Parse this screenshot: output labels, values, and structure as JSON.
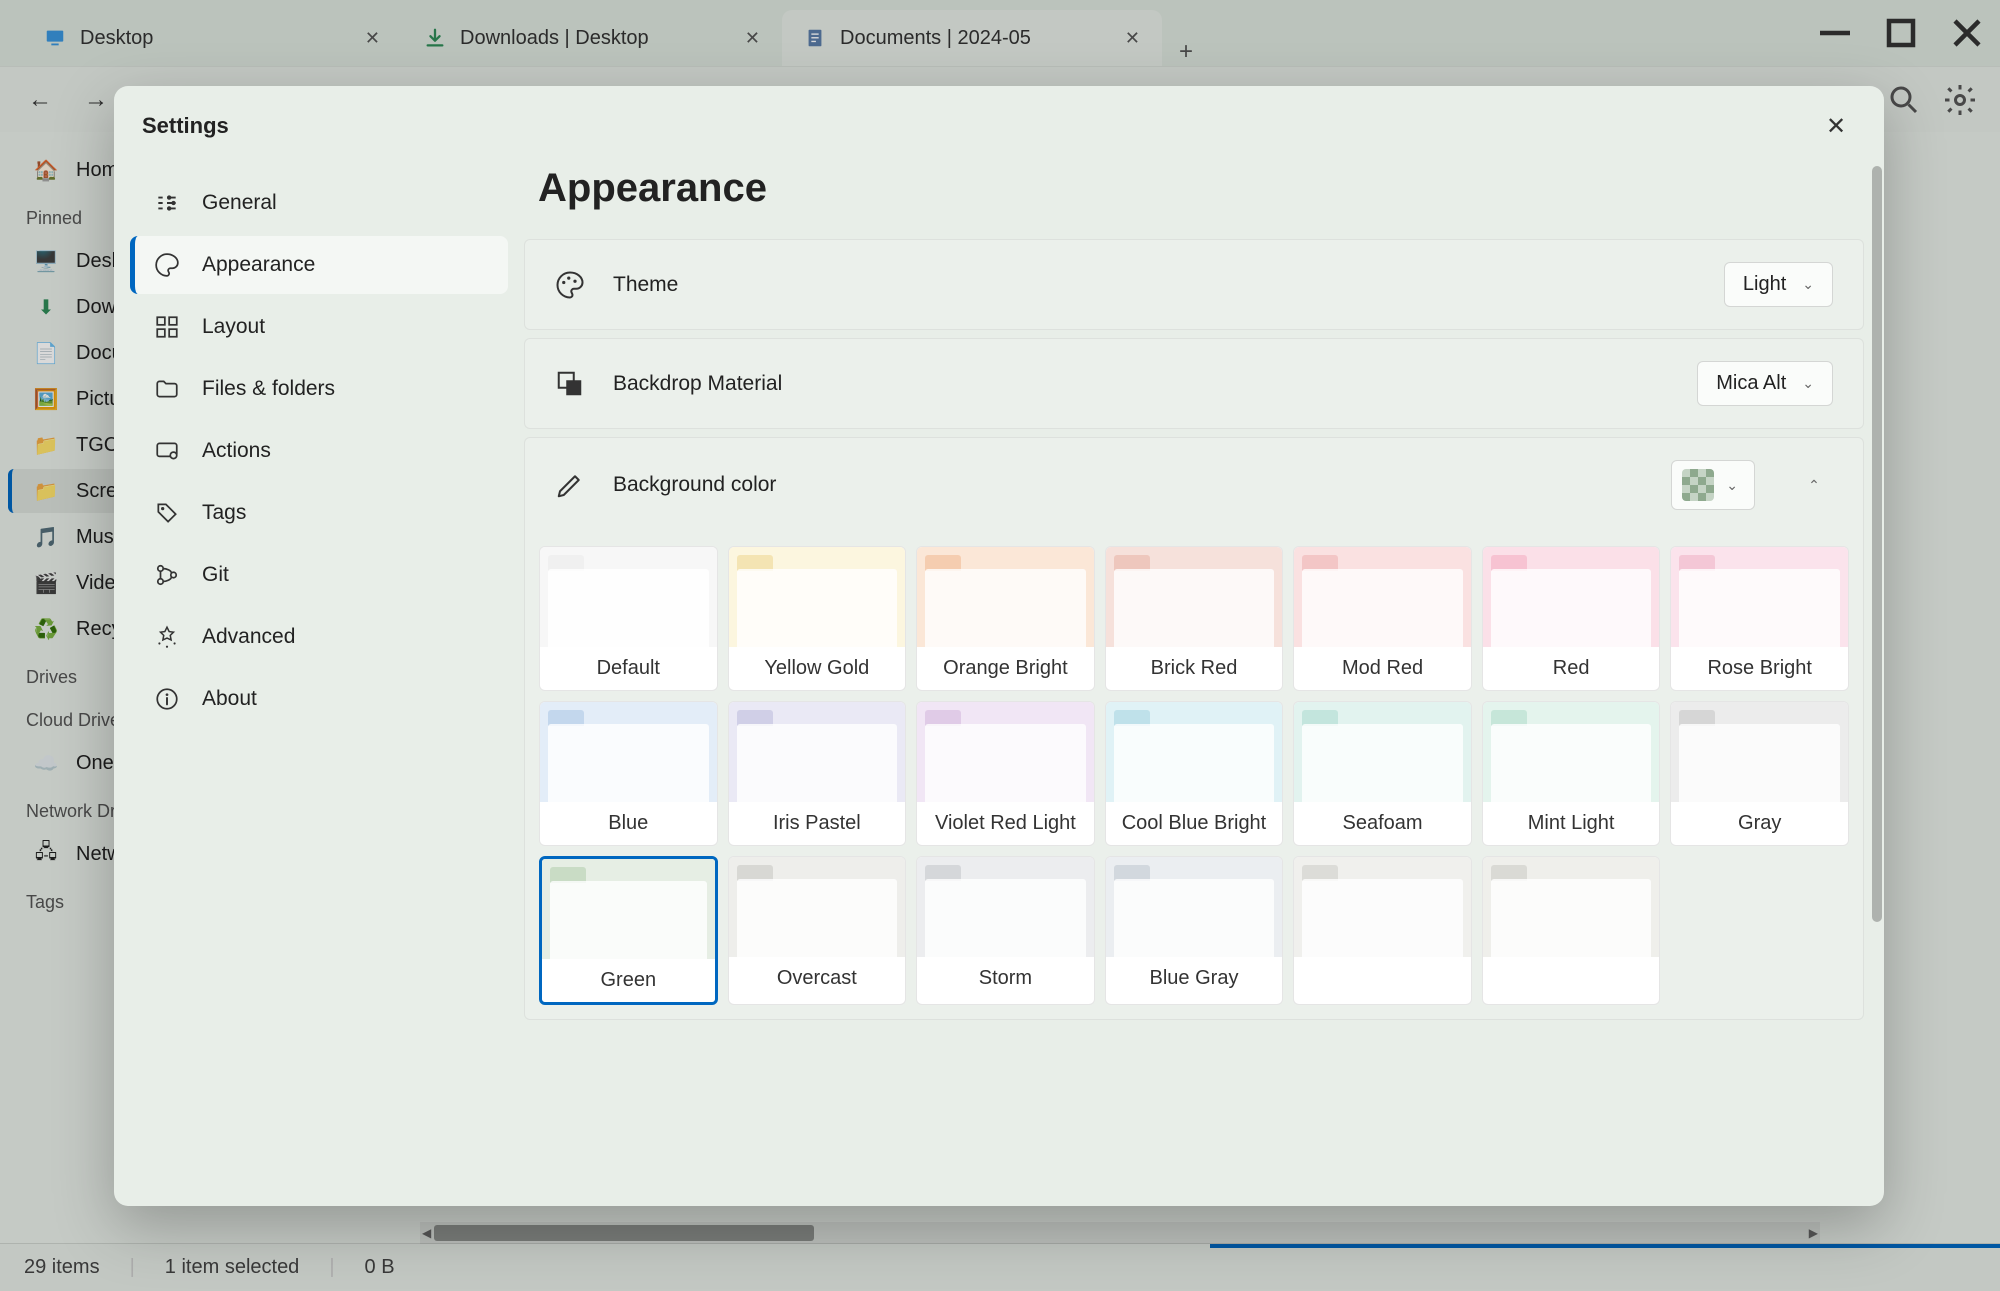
{
  "window": {
    "tabs": [
      {
        "label": "Desktop",
        "icon": "desktop",
        "active": false
      },
      {
        "label": "Downloads | Desktop",
        "icon": "download",
        "active": false
      },
      {
        "label": "Documents | 2024-05",
        "icon": "document",
        "active": true
      }
    ]
  },
  "sidebar": {
    "home": "Home",
    "pinned_header": "Pinned",
    "pinned": [
      "Desktop",
      "Downloads",
      "Documents",
      "Pictures",
      "TGC",
      "Screenshots",
      "Music",
      "Videos",
      "Recycle"
    ],
    "drives_header": "Drives",
    "cloud_header": "Cloud Drives",
    "cloud": [
      "OneDrive"
    ],
    "network_header": "Network Drives",
    "network": [
      "Network"
    ],
    "tags_header": "Tags"
  },
  "status": {
    "items": "29 items",
    "selected": "1 item selected",
    "size": "0 B"
  },
  "settings": {
    "title": "Settings",
    "nav": [
      "General",
      "Appearance",
      "Layout",
      "Files & folders",
      "Actions",
      "Tags",
      "Git",
      "Advanced",
      "About"
    ],
    "active_nav_index": 1,
    "page_title": "Appearance",
    "theme": {
      "label": "Theme",
      "value": "Light"
    },
    "backdrop": {
      "label": "Backdrop Material",
      "value": "Mica Alt"
    },
    "bgcolor": {
      "label": "Background color"
    },
    "colors": [
      {
        "name": "Default",
        "tab": "#f0f0f0",
        "body": "#f7f7f7"
      },
      {
        "name": "Yellow Gold",
        "tab": "#f4e4b3",
        "body": "#fcf6df"
      },
      {
        "name": "Orange Bright",
        "tab": "#f5cdb0",
        "body": "#fbe7d7"
      },
      {
        "name": "Brick Red",
        "tab": "#eec7bd",
        "body": "#f6e1db"
      },
      {
        "name": "Mod Red",
        "tab": "#f3c6c6",
        "body": "#fae1e1"
      },
      {
        "name": "Red",
        "tab": "#f7c3d2",
        "body": "#fbe0e8"
      },
      {
        "name": "Rose Bright",
        "tab": "#f4c7d6",
        "body": "#fbe3ec"
      },
      {
        "name": "Blue",
        "tab": "#c3d7ed",
        "body": "#e3edf8"
      },
      {
        "name": "Iris Pastel",
        "tab": "#d0cfe7",
        "body": "#eae9f5"
      },
      {
        "name": "Violet Red Light",
        "tab": "#e0cbe7",
        "body": "#f1e6f5"
      },
      {
        "name": "Cool Blue Bright",
        "tab": "#bfe1ea",
        "body": "#e0f2f6"
      },
      {
        "name": "Seafoam",
        "tab": "#c3e5dd",
        "body": "#e2f3ef"
      },
      {
        "name": "Mint Light",
        "tab": "#c6e6d9",
        "body": "#e4f4ed"
      },
      {
        "name": "Gray",
        "tab": "#d6d6d6",
        "body": "#ececec"
      },
      {
        "name": "Green",
        "tab": "#c9dcc5",
        "body": "#e6eee4",
        "selected": true
      },
      {
        "name": "Overcast",
        "tab": "#d8d8d4",
        "body": "#eeeeeb"
      },
      {
        "name": "Storm",
        "tab": "#d5d7da",
        "body": "#ecedef"
      },
      {
        "name": "Blue Gray",
        "tab": "#d2d8de",
        "body": "#ebeef1"
      },
      {
        "name": "",
        "tab": "#dcdcd8",
        "body": "#f0f0ed"
      },
      {
        "name": "",
        "tab": "#dadad5",
        "body": "#efefeb"
      }
    ]
  }
}
